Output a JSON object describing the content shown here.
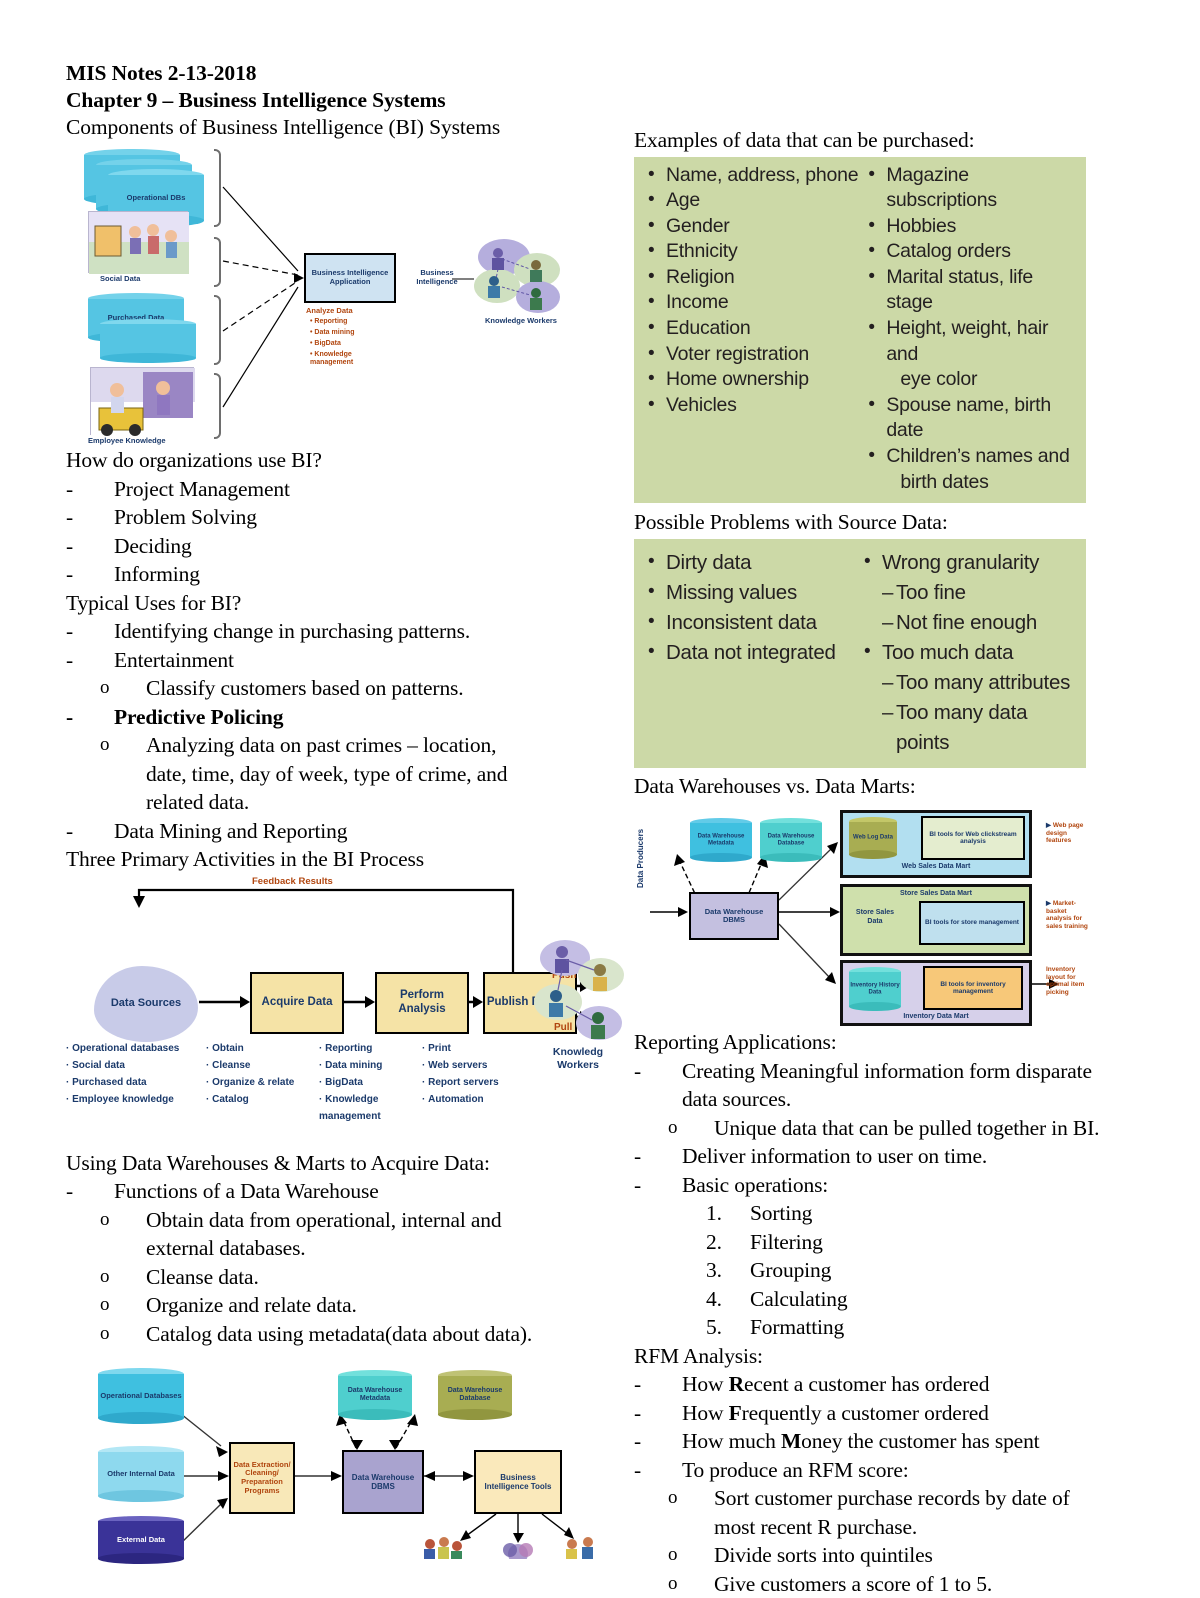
{
  "document": {
    "title_line1": "MIS Notes 2-13-2018",
    "title_line2": "Chapter 9 – Business Intelligence Systems"
  },
  "left_column": {
    "heading_components": "Components of Business Intelligence (BI) Systems",
    "diagram_components": {
      "name": "components-of-bi-systems-diagram",
      "sources": [
        "Operational DBs",
        "Social Data",
        "Purchased Data",
        "Employee Knowledge"
      ],
      "center_box": "Business Intelligence Application",
      "center_caption_title": "Analyze Data",
      "center_caption_items": [
        "Reporting",
        "Data mining",
        "BigData",
        "Knowledge management"
      ],
      "flow_label": "Business Intelligence",
      "output_label": "Knowledge Workers"
    },
    "heading_how": "How do organizations use BI?",
    "how_items": [
      "Project Management",
      "Problem Solving",
      "Deciding",
      "Informing"
    ],
    "heading_typical": "Typical Uses for BI?",
    "typical_items": [
      {
        "text": "Identifying change in purchasing patterns.",
        "bold": false
      },
      {
        "text": "Entertainment",
        "bold": false
      },
      {
        "text": "Predictive Policing",
        "bold": true
      },
      {
        "text": "Data Mining and Reporting",
        "bold": false
      }
    ],
    "typical_sub_entertainment": "Classify customers based on patterns.",
    "typical_sub_policing_l1": "Analyzing data on past crimes – location,",
    "typical_sub_policing_l2": "date, time, day of week, type of crime, and",
    "typical_sub_policing_l3": "related data.",
    "heading_three": "Three Primary Activities in the BI Process",
    "diagram_process": {
      "name": "bi-process-diagram",
      "feedback_label": "Feedback Results",
      "source_node": "Data Sources",
      "steps": [
        "Acquire Data",
        "Perform Analysis",
        "Publish Results"
      ],
      "push_label": "Push",
      "pull_label": "Pull",
      "workers_label": "Knowledg Workers",
      "columns": [
        [
          "Operational databases",
          "Social data",
          "Purchased data",
          "Employee knowledge"
        ],
        [
          "Obtain",
          "Cleanse",
          "Organize & relate",
          "Catalog"
        ],
        [
          "Reporting",
          "Data mining",
          "BigData",
          "Knowledge management"
        ],
        [
          "Print",
          "Web servers",
          "Report servers",
          "Automation"
        ]
      ]
    },
    "heading_using": "Using Data Warehouses & Marts to Acquire Data:",
    "using_bullet": "Functions of a Data Warehouse",
    "using_sub": [
      "Obtain data from operational, internal and",
      "external databases.",
      "Cleanse data.",
      "Organize and relate data.",
      "Catalog data using metadata(data about data)."
    ],
    "diagram_warehouse": {
      "name": "data-warehouse-components-diagram",
      "sources": [
        "Operational Databases",
        "Other Internal Data",
        "External Data"
      ],
      "etl_box": "Data Extraction/ Cleaning/ Preparation Programs",
      "dbms_box": "Data Warehouse DBMS",
      "stores": [
        "Data Warehouse Metadata",
        "Data Warehouse Database"
      ],
      "bi_box": "Business Intelligence Tools"
    }
  },
  "right_column": {
    "heading_purchased": "Examples of data that can be purchased:",
    "purchased_left": [
      "Name, address, phone",
      "Age",
      "Gender",
      "Ethnicity",
      "Religion",
      "Income",
      "Education",
      "Voter registration",
      "Home ownership",
      "Vehicles"
    ],
    "purchased_right": [
      {
        "text": "Magazine subscriptions",
        "dot": true
      },
      {
        "text": "Hobbies",
        "dot": true
      },
      {
        "text": "Catalog orders",
        "dot": true
      },
      {
        "text": "Marital status, life stage",
        "dot": true
      },
      {
        "text": "Height, weight, hair and",
        "dot": true
      },
      {
        "text": "eye color",
        "dot": false
      },
      {
        "text": "Spouse name, birth date",
        "dot": true
      },
      {
        "text": "Children’s names and",
        "dot": true
      },
      {
        "text": "birth dates",
        "dot": false
      }
    ],
    "heading_problems": "Possible Problems with Source Data:",
    "problems_left": [
      "Dirty data",
      "Missing values",
      "Inconsistent data",
      "Data not integrated"
    ],
    "problems_right": [
      {
        "text": "Wrong granularity",
        "type": "dot"
      },
      {
        "text": "Too fine",
        "type": "dash"
      },
      {
        "text": "Not fine enough",
        "type": "dash"
      },
      {
        "text": "Too much data",
        "type": "dot"
      },
      {
        "text": "Too many attributes",
        "type": "dash"
      },
      {
        "text": "Too many data points",
        "type": "dash"
      }
    ],
    "heading_marts": "Data Warehouses vs. Data Marts:",
    "diagram_marts": {
      "name": "data-warehouse-vs-data-marts-diagram",
      "producers_label": "Data Producers",
      "stores": [
        "Data Warehouse Metadata",
        "Data Warehouse Database"
      ],
      "dbms_box": "Data Warehouse DBMS",
      "marts": [
        {
          "data": "Web Log Data",
          "tools": "BI tools for Web clickstream analysis",
          "title": "Web Sales Data Mart",
          "outcome": "Web page design features"
        },
        {
          "data": "Store Sales Data",
          "tools": "BI tools for store management",
          "title": "Store Sales Data Mart",
          "outcome": "Market-basket analysis for sales training"
        },
        {
          "data": "Inventory History Data",
          "tools": "BI tools for inventory management",
          "title": "Inventory Data Mart",
          "outcome": "Inventory layout for optimal item picking"
        }
      ]
    },
    "heading_reporting": "Reporting Applications:",
    "reporting_l1a": "Creating Meaningful information form disparate",
    "reporting_l1b": "data sources.",
    "reporting_sub": "Unique data that can be pulled together in BI.",
    "reporting_l2": "Deliver information to user on time.",
    "reporting_l3": "Basic operations:",
    "reporting_ops": [
      "Sorting",
      "Filtering",
      "Grouping",
      "Calculating",
      "Formatting"
    ],
    "heading_rfm": "RFM Analysis:",
    "rfm_items": [
      {
        "pre": "How ",
        "bold": "R",
        "post": "ecent a customer has ordered"
      },
      {
        "pre": "How ",
        "bold": "F",
        "post": "requently a customer ordered"
      },
      {
        "pre": "How much ",
        "bold": "M",
        "post": "oney the customer has spent"
      },
      {
        "pre": "To produce an RFM score:",
        "bold": "",
        "post": ""
      }
    ],
    "rfm_sub": [
      "Sort customer purchase records by date of",
      "most recent R purchase.",
      "Divide sorts into quintiles",
      "Give customers a score of 1 to 5."
    ]
  },
  "colors": {
    "green_box": "#ccd9a7",
    "node_yellow": "#f5e3a6",
    "node_purple": "#a9a3cf",
    "node_blue_label": "#1b3a6b",
    "cyl_cyan": "#3fc0e0",
    "cyl_teal": "#4fcfce",
    "cyl_olive": "#a8ad52",
    "cyl_navy": "#39369c",
    "mart_blue": "#b2dff0",
    "mart_green": "#cfe0ac",
    "mart_purple": "#d6d0ea"
  }
}
